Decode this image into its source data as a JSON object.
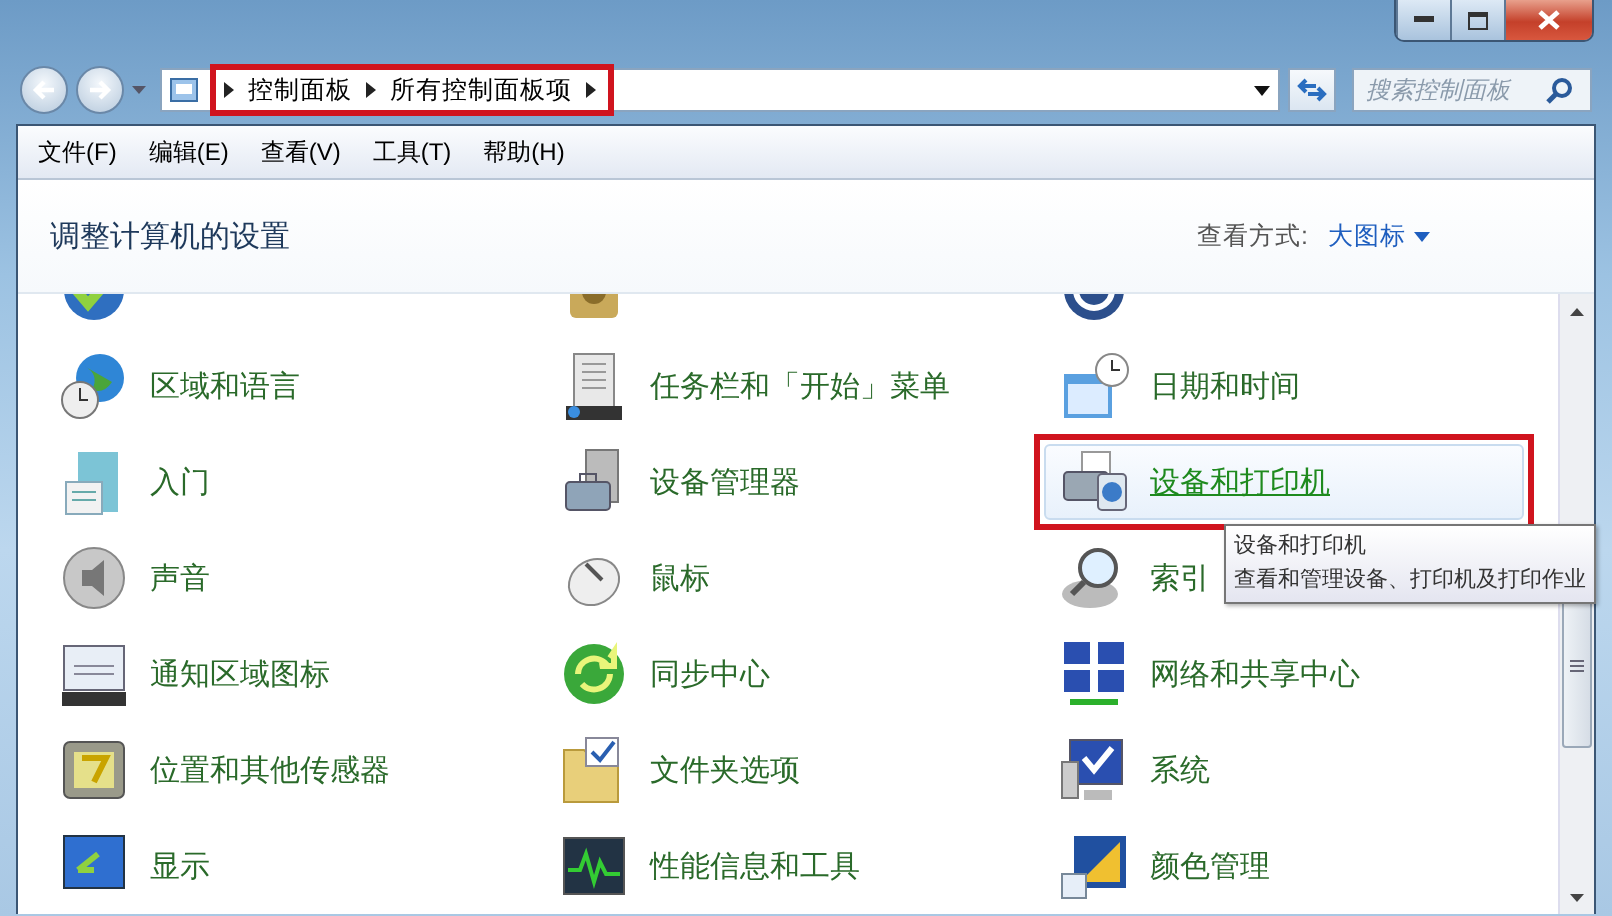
{
  "window": {
    "controls": [
      {
        "kind": "minimize"
      },
      {
        "kind": "maximize"
      },
      {
        "kind": "close"
      }
    ]
  },
  "address_bar": {
    "breadcrumb": [
      "控制面板",
      "所有控制面板项"
    ],
    "highlighted": true
  },
  "search": {
    "placeholder": "搜索控制面板"
  },
  "menu": [
    "文件(F)",
    "编辑(E)",
    "查看(V)",
    "工具(T)",
    "帮助(H)"
  ],
  "header": {
    "title": "调整计算机的设置",
    "view_label": "查看方式:",
    "view_value": "大图标"
  },
  "items": [
    {
      "kind": "check-shield",
      "selected": false,
      "highlighted": false
    },
    {
      "kind": "vault",
      "selected": false,
      "highlighted": false
    },
    {
      "kind": "access",
      "selected": false,
      "highlighted": false
    },
    {
      "kind": "globe-clock",
      "label": "区域和语言",
      "selected": false,
      "highlighted": false
    },
    {
      "kind": "taskbar",
      "label": "任务栏和「开始」菜单",
      "selected": false,
      "highlighted": false
    },
    {
      "kind": "calendar",
      "label": "日期和时间",
      "selected": false,
      "highlighted": false
    },
    {
      "kind": "start",
      "label": "入门",
      "selected": false,
      "highlighted": false
    },
    {
      "kind": "toolbox",
      "label": "设备管理器",
      "selected": false,
      "highlighted": false
    },
    {
      "kind": "printer",
      "label": "设备和打印机",
      "selected": true,
      "highlighted": true
    },
    {
      "kind": "speaker",
      "label": "声音",
      "selected": false,
      "highlighted": false
    },
    {
      "kind": "mouse",
      "label": "鼠标",
      "selected": false,
      "highlighted": false
    },
    {
      "kind": "magnifier",
      "label": "索引",
      "selected": false,
      "highlighted": false
    },
    {
      "kind": "tray",
      "label": "通知区域图标",
      "selected": false,
      "highlighted": false
    },
    {
      "kind": "sync",
      "label": "同步中心",
      "selected": false,
      "highlighted": false
    },
    {
      "kind": "network",
      "label": "网络和共享中心",
      "selected": false,
      "highlighted": false
    },
    {
      "kind": "sensor",
      "label": "位置和其他传感器",
      "selected": false,
      "highlighted": false
    },
    {
      "kind": "folder",
      "label": "文件夹选项",
      "selected": false,
      "highlighted": false
    },
    {
      "kind": "monitor",
      "label": "系统",
      "selected": false,
      "highlighted": false
    },
    {
      "kind": "display",
      "label": "显示",
      "selected": false,
      "highlighted": false
    },
    {
      "kind": "graph",
      "label": "性能信息和工具",
      "selected": false,
      "highlighted": false
    },
    {
      "kind": "color",
      "label": "颜色管理",
      "selected": false,
      "highlighted": false
    }
  ],
  "tooltip": {
    "title": "设备和打印机",
    "description": "查看和管理设备、打印机及打印作业"
  }
}
